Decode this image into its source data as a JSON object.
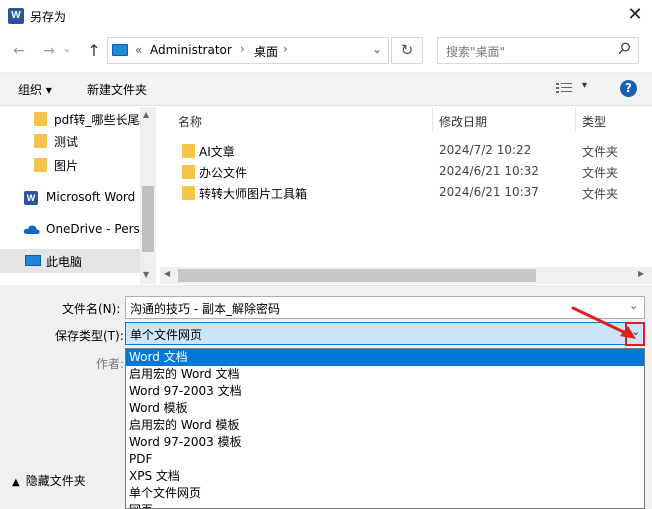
{
  "window": {
    "title": "另存为",
    "app_icon_letter": "W",
    "close_glyph": "✕"
  },
  "nav": {
    "back_glyph": "←",
    "forward_glyph": "→",
    "recent_glyph": "⌄",
    "up_glyph": "↑",
    "breadcrumb_sep": "«",
    "crumbs": [
      "Administrator",
      "桌面"
    ],
    "refresh_glyph": "↻",
    "search_placeholder": "搜索\"桌面\""
  },
  "toolbar": {
    "organize": "组织 ▾",
    "new_folder": "新建文件夹"
  },
  "sidebar": {
    "items": [
      {
        "label": "pdf转_哪些长尾",
        "icon": "folder-icon"
      },
      {
        "label": "测试",
        "icon": "folder-icon"
      },
      {
        "label": "图片",
        "icon": "folder-icon"
      },
      {
        "label": "Microsoft Word",
        "icon": "word-icon"
      },
      {
        "label": "OneDrive - Perso",
        "icon": "onedrive-icon"
      },
      {
        "label": "此电脑",
        "icon": "pc-icon"
      }
    ]
  },
  "filelist": {
    "columns": [
      "名称",
      "修改日期",
      "类型"
    ],
    "rows": [
      {
        "name": "AI文章",
        "date": "2024/7/2 10:22",
        "type": "文件夹"
      },
      {
        "name": "办公文件",
        "date": "2024/6/21 10:32",
        "type": "文件夹"
      },
      {
        "name": "转转大师图片工具箱",
        "date": "2024/6/21 10:37",
        "type": "文件夹"
      }
    ]
  },
  "form": {
    "filename_label": "文件名(N):",
    "filename_value": "沟通的技巧 - 副本_解除密码",
    "filetype_label": "保存类型(T):",
    "filetype_value": "单个文件网页",
    "author_label": "作者:"
  },
  "dropdown": {
    "options": [
      "Word 文档",
      "启用宏的 Word 文档",
      "Word 97-2003 文档",
      "Word 模板",
      "启用宏的 Word 模板",
      "Word 97-2003 模板",
      "PDF",
      "XPS 文档",
      "单个文件网页",
      "网页"
    ],
    "selected_index": 0
  },
  "footer": {
    "hide_folders": "隐藏文件夹"
  },
  "colors": {
    "selection": "#0078d7",
    "annotation": "#e02020"
  }
}
